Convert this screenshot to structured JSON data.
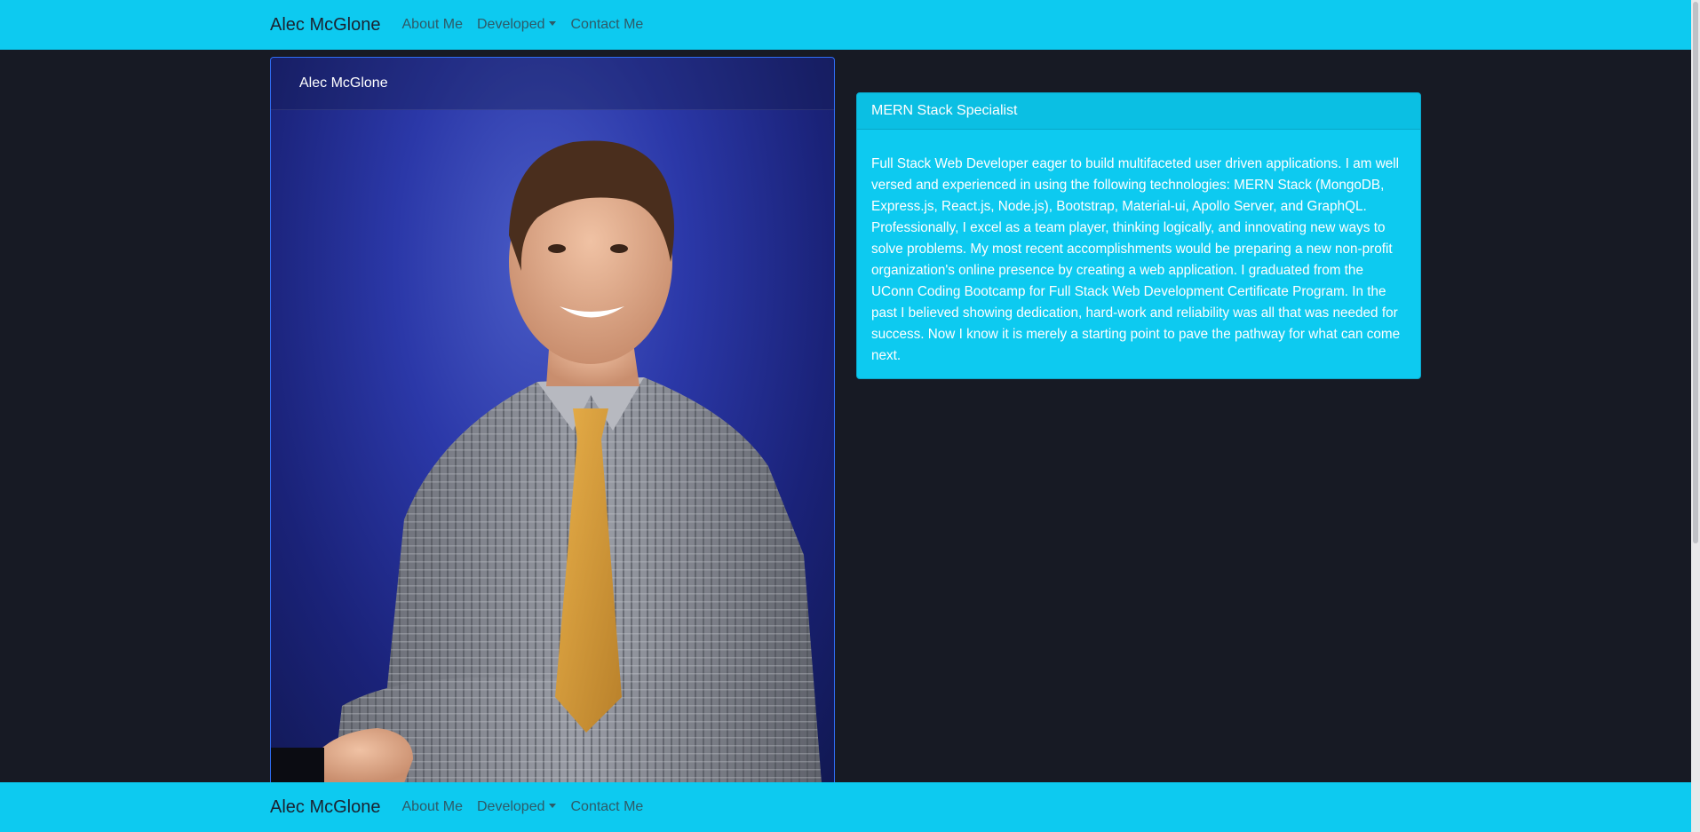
{
  "navbar": {
    "brand": "Alec McGlone",
    "links": [
      {
        "label": "About Me"
      },
      {
        "label": "Developed",
        "dropdown": true
      },
      {
        "label": "Contact Me"
      }
    ]
  },
  "footer": {
    "brand": "Alec McGlone",
    "links": [
      {
        "label": "About Me"
      },
      {
        "label": "Developed",
        "dropdown": true
      },
      {
        "label": "Contact Me"
      }
    ]
  },
  "profile_card": {
    "name": "Alec McGlone",
    "photo": "portrait-photo"
  },
  "bio_card": {
    "title": "MERN Stack Specialist",
    "body": "Full Stack Web Developer eager to build multifaceted user driven applications. I am well versed and experienced in using the following technologies: MERN Stack (MongoDB, Express.js, React.js, Node.js), Bootstrap, Material-ui, Apollo Server, and GraphQL. Professionally, I excel as a team player, thinking logically, and innovating new ways to solve problems. My most recent accomplishments would be preparing a new non-profit organization's online presence by creating a web application. I graduated from the UConn Coding Bootcamp for Full Stack Web Development Certificate Program. In the past I believed showing dedication, hard-work and reliability was all that was needed for success. Now I know it is merely a starting point to pave the pathway for what can come next."
  },
  "colors": {
    "navbar": "#0dcaf0",
    "background": "#171a24",
    "card_border": "#2f6df3"
  }
}
